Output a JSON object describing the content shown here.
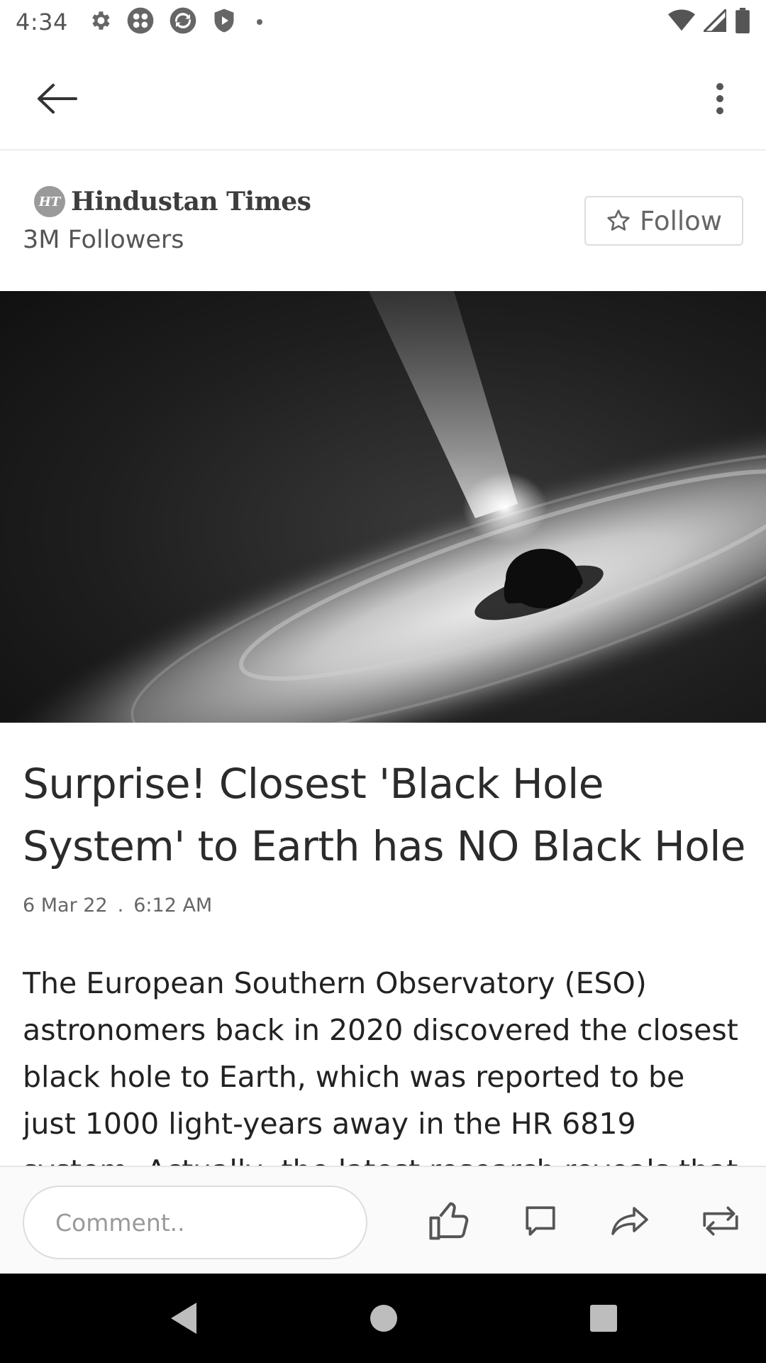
{
  "status_bar": {
    "time": "4:34",
    "left_icons": [
      "settings-icon",
      "app-icon",
      "sync-icon",
      "shield-play-icon",
      "dot"
    ],
    "right_icons": [
      "wifi-icon",
      "signal-icon",
      "battery-icon"
    ]
  },
  "app_bar": {
    "back_icon": "arrow-left-icon",
    "more_icon": "more-vert-icon"
  },
  "publisher": {
    "logo_initials": "HT",
    "name": "Hindustan Times",
    "followers": "3M Followers",
    "follow_label": "Follow"
  },
  "article": {
    "headline": "Surprise! Closest 'Black Hole System' to Earth has NO Black Hole",
    "date": "6 Mar 22",
    "separator": ".",
    "time": "6:12 AM",
    "body": "The European Southern Observatory (ESO) astronomers back in 2020 discovered the closest black hole to Earth, which was reported to be just 1000 light-years away in the HR 6819 system. Actually, the latest research reveals that the earlier"
  },
  "action_bar": {
    "comment_placeholder": "Comment..",
    "icons": [
      "like-icon",
      "comment-icon",
      "share-icon",
      "repost-icon"
    ]
  },
  "colors": {
    "icon_gray": "#555555",
    "nav_background": "#000000"
  }
}
